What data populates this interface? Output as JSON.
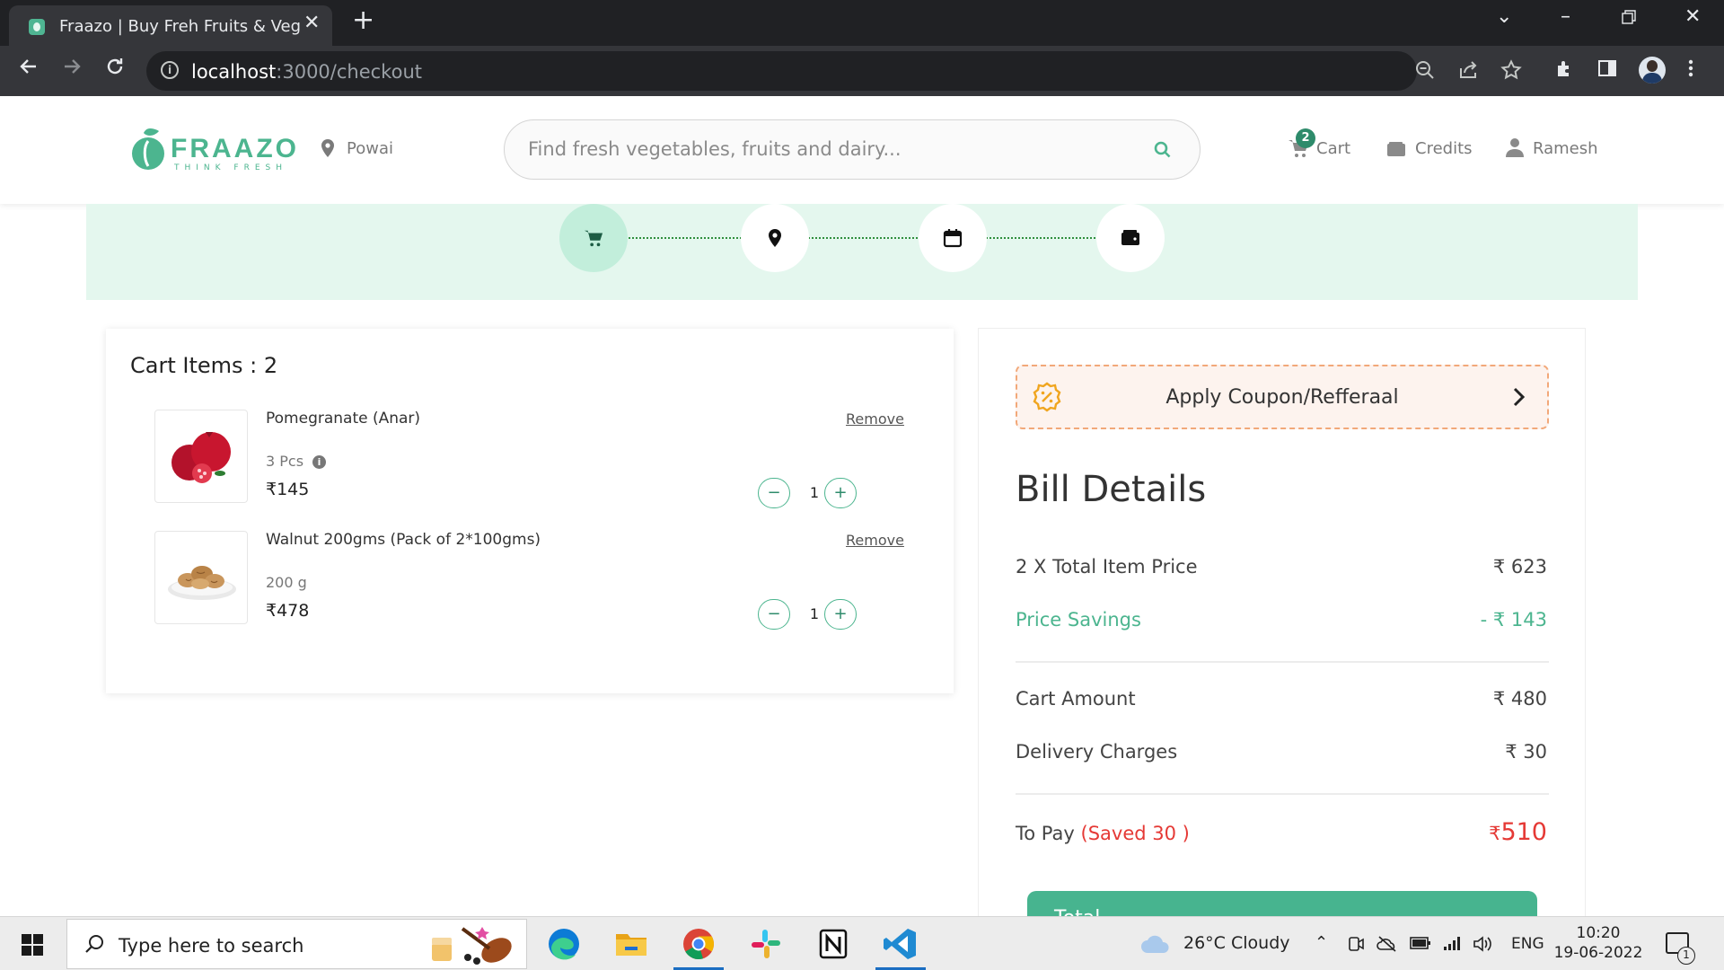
{
  "browser": {
    "tab_title": "Fraazo | Buy Freh Fruits & Vegitables",
    "tab_close": "✕",
    "new_tab": "+",
    "url_host": "localhost",
    "url_path": ":3000/checkout",
    "icons": [
      "back-icon",
      "forward-icon",
      "reload-icon",
      "info-icon",
      "zoom-out-icon",
      "share-icon",
      "star-icon",
      "extensions-icon",
      "side-panel-icon",
      "profile-avatar",
      "menu-icon"
    ]
  },
  "header": {
    "logo_text": "FRAAZO",
    "logo_tagline": "THINK FRESH",
    "location": "Powai",
    "search_placeholder": "Find fresh vegetables, fruits and dairy...",
    "cart_label": "Cart",
    "cart_count": "2",
    "credits_label": "Credits",
    "user_label": "Ramesh"
  },
  "stepper": {
    "steps": [
      "cart",
      "address",
      "schedule",
      "payment"
    ],
    "active_step": "cart"
  },
  "cart": {
    "title": "Cart Items : 2",
    "items": [
      {
        "name": "Pomegranate (Anar)",
        "quantity": "3 Pcs",
        "price": "₹145",
        "count": "1",
        "remove_label": "Remove",
        "minus": "−",
        "plus": "+"
      },
      {
        "name": "Walnut 200gms (Pack of 2*100gms)",
        "quantity": "200 g",
        "price": "₹478",
        "count": "1",
        "remove_label": "Remove",
        "minus": "−",
        "plus": "+"
      }
    ]
  },
  "bill": {
    "coupon_label": "Apply Coupon/Refferaal",
    "title": "Bill Details",
    "total_item_price_label": "2 X Total Item Price",
    "total_item_price_value": "₹ 623",
    "price_savings_label": "Price Savings",
    "price_savings_value": "- ₹ 143",
    "cart_amount_label": "Cart Amount",
    "cart_amount_value": "₹ 480",
    "delivery_label": "Delivery Charges",
    "delivery_value": "₹ 30",
    "to_pay_label": "To Pay",
    "saved_label": "(Saved 30 )",
    "to_pay_currency": "₹",
    "to_pay_value": "510",
    "total_button": "Total"
  },
  "taskbar": {
    "search_placeholder": "Type here to search",
    "weather": "26°C  Cloudy",
    "language": "ENG",
    "time": "10:20",
    "date": "19-06-2022",
    "notifications": "1"
  },
  "colors": {
    "brand_green": "#4cb58f",
    "savings_red": "#e53935",
    "stepper_bg": "#e4f7ee",
    "coupon_border": "#f2a879"
  }
}
